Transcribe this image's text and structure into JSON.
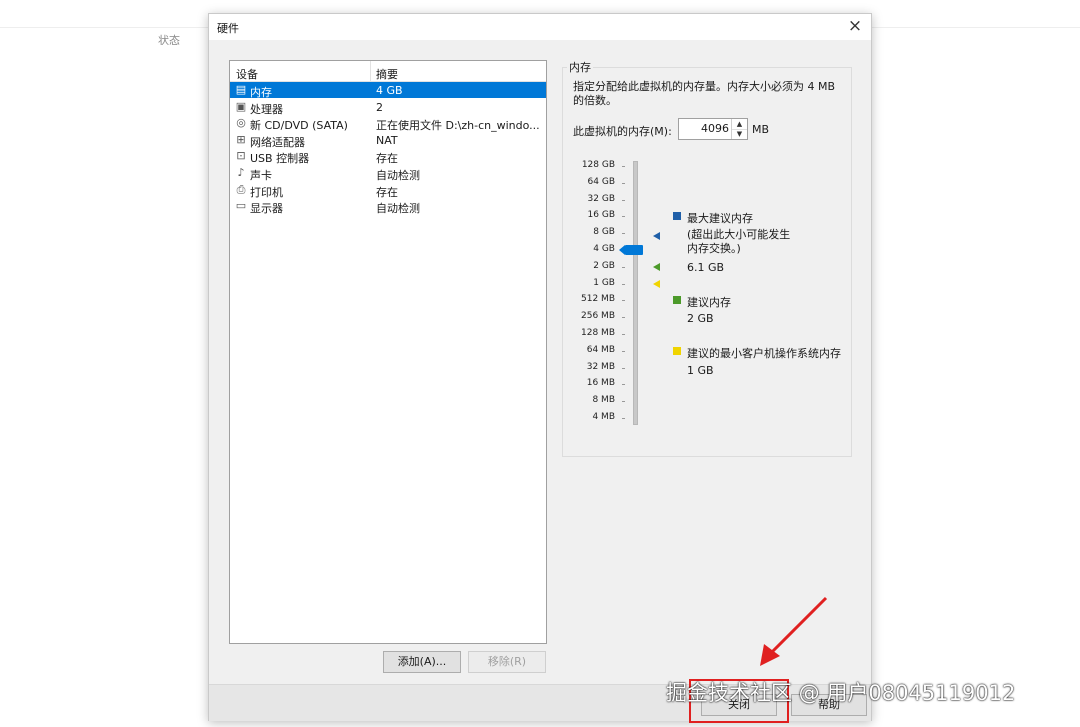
{
  "background": {
    "status_label": "状态"
  },
  "dialog": {
    "title": "硬件",
    "close_glyph": "×",
    "device_list": {
      "col_device": "设备",
      "col_summary": "摘要",
      "rows": [
        {
          "icon": "memory-icon",
          "glyph": "▤",
          "name": "内存",
          "value": "4 GB",
          "selected": true
        },
        {
          "icon": "processor-icon",
          "glyph": "▣",
          "name": "处理器",
          "value": "2"
        },
        {
          "icon": "cd-dvd-icon",
          "glyph": "◎",
          "name": "新 CD/DVD (SATA)",
          "value": "正在使用文件 D:\\zh-cn_windo..."
        },
        {
          "icon": "network-adapter-icon",
          "glyph": "⊞",
          "name": "网络适配器",
          "value": "NAT"
        },
        {
          "icon": "usb-controller-icon",
          "glyph": "⊡",
          "name": "USB 控制器",
          "value": "存在"
        },
        {
          "icon": "sound-card-icon",
          "glyph": "♪",
          "name": "声卡",
          "value": "自动检测"
        },
        {
          "icon": "printer-icon",
          "glyph": "⎙",
          "name": "打印机",
          "value": "存在"
        },
        {
          "icon": "display-icon",
          "glyph": "▭",
          "name": "显示器",
          "value": "自动检测"
        }
      ]
    },
    "buttons": {
      "add": "添加(A)...",
      "remove": "移除(R)",
      "close": "关闭",
      "help": "帮助"
    },
    "memory": {
      "group_title": "内存",
      "description": "指定分配给此虚拟机的内存量。内存大小必须为 4 MB 的倍数。",
      "label": "此虚拟机的内存(M):",
      "value": "4096",
      "unit": "MB",
      "scale_ticks": [
        "128 GB",
        "64 GB",
        "32 GB",
        "16 GB",
        "8 GB",
        "4 GB",
        "2 GB",
        "1 GB",
        "512 MB",
        "256 MB",
        "128 MB",
        "64 MB",
        "32 MB",
        "16 MB",
        "8 MB",
        "4 MB"
      ],
      "legend": {
        "max_title": "最大建议内存",
        "max_note": "(超出此大小可能发生内存交换。)",
        "max_value": "6.1 GB",
        "rec_title": "建议内存",
        "rec_value": "2 GB",
        "min_title": "建议的最小客户机操作系统内存",
        "min_value": "1 GB"
      },
      "colors": {
        "max": "#1f5fa8",
        "recommended": "#4c9a2a",
        "minimum": "#f0d400"
      }
    }
  },
  "watermark": "掘金技术社区 @ 用户08045119012"
}
